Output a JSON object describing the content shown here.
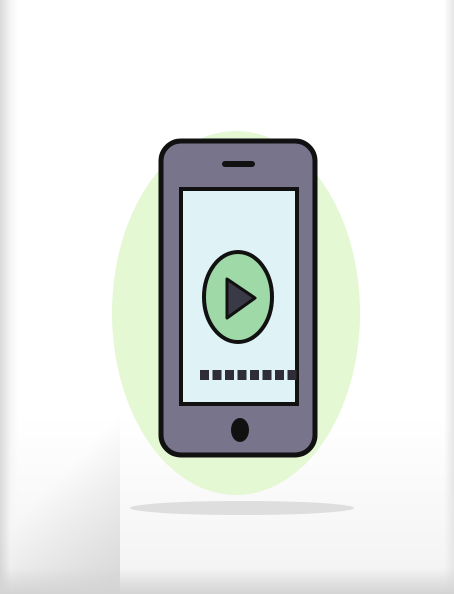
{
  "illustration": {
    "subject": "smartphone-video-player",
    "icons": [
      "smartphone-icon",
      "play-icon"
    ],
    "colors": {
      "background_blob": "#e3f8d3",
      "phone_body": "#77748c",
      "phone_outline": "#111111",
      "screen": "#dff3f7",
      "play_circle": "#9ed9a7",
      "play_triangle": "#3a3946",
      "shadow": "#dedede"
    },
    "progress_segments": 8
  }
}
